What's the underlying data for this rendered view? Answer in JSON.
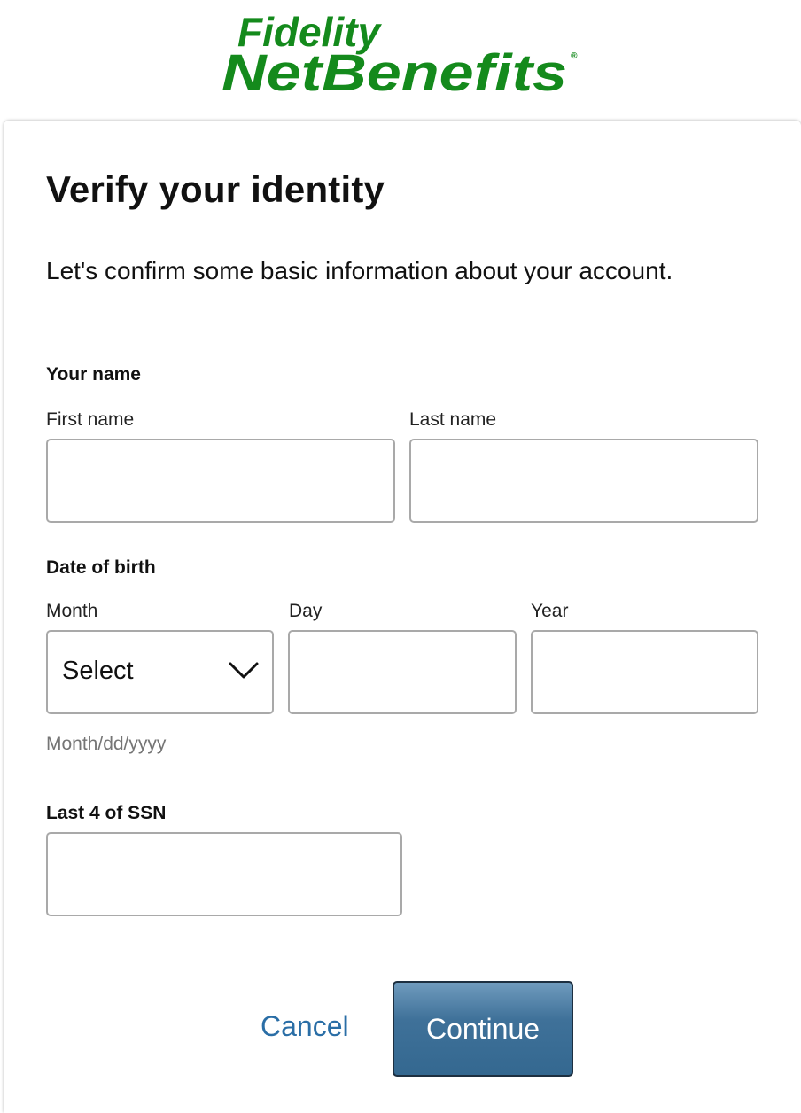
{
  "brand": {
    "line1": "Fidelity",
    "line2": "NetBenefits",
    "registered_mark": "®",
    "color": "#148a1c"
  },
  "form": {
    "title": "Verify your identity",
    "intro": "Let's confirm some basic information about your account.",
    "name_section": {
      "label": "Your name",
      "first_name": {
        "label": "First name",
        "value": "",
        "placeholder": ""
      },
      "last_name": {
        "label": "Last name",
        "value": "",
        "placeholder": ""
      }
    },
    "dob_section": {
      "label": "Date of birth",
      "month": {
        "label": "Month",
        "selected": "Select",
        "icon": "chevron-down-icon"
      },
      "day": {
        "label": "Day",
        "value": "",
        "placeholder": ""
      },
      "year": {
        "label": "Year",
        "value": "",
        "placeholder": ""
      },
      "hint": "Month/dd/yyyy"
    },
    "ssn_section": {
      "label": "Last 4 of SSN",
      "value": "",
      "placeholder": ""
    }
  },
  "actions": {
    "cancel_label": "Cancel",
    "continue_label": "Continue",
    "cancel_color": "#2a6ea6",
    "continue_color": "#3f7199"
  }
}
